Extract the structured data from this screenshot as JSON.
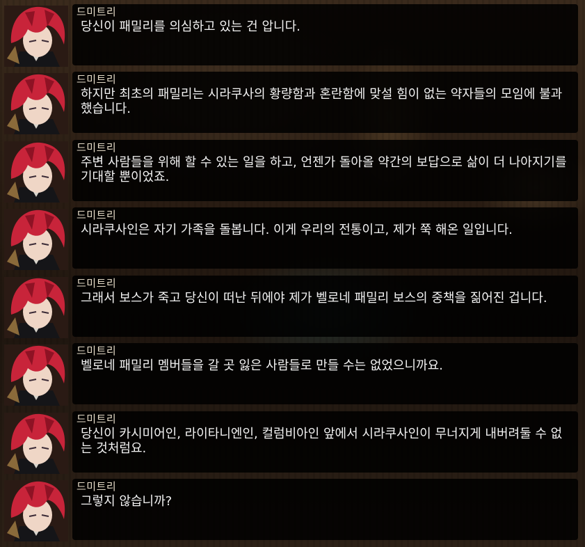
{
  "dialogue_log": [
    {
      "speaker": "드미트리",
      "text": "당신이 패밀리를 의심하고 있는 건 압니다."
    },
    {
      "speaker": "드미트리",
      "text": "하지만 최초의 패밀리는 시라쿠사의 황량함과 혼란함에 맞설 힘이 없는 약자들의 모임에 불과했습니다."
    },
    {
      "speaker": "드미트리",
      "text": "주변 사람들을 위해 할 수 있는 일을 하고, 언젠가 돌아올 약간의 보답으로 삶이 더 나아지기를 기대할 뿐이었죠."
    },
    {
      "speaker": "드미트리",
      "text": "시라쿠사인은 자기 가족을 돌봅니다. 이게 우리의 전통이고, 제가 쭉 해온 일입니다."
    },
    {
      "speaker": "드미트리",
      "text": "그래서 보스가 죽고 당신이 떠난 뒤에야 제가 벨로네 패밀리 보스의 중책을 짊어진 겁니다."
    },
    {
      "speaker": "드미트리",
      "text": "벨로네 패밀리 멤버들을 갈 곳 잃은 사람들로 만들 수는 없었으니까요."
    },
    {
      "speaker": "드미트리",
      "text": "당신이 카시미어인, 라이타니엔인, 컬럼비아인 앞에서 시라쿠사인이 무너지게 내버려둘 수 없는 것처럼요."
    },
    {
      "speaker": "드미트리",
      "text": "그렇지 않습니까?"
    }
  ],
  "colors": {
    "bubble_bg": "#000000",
    "speaker_text": "#e6dcc8",
    "line_text": "#f2f2f2",
    "portrait_hair": "#c8243a"
  }
}
